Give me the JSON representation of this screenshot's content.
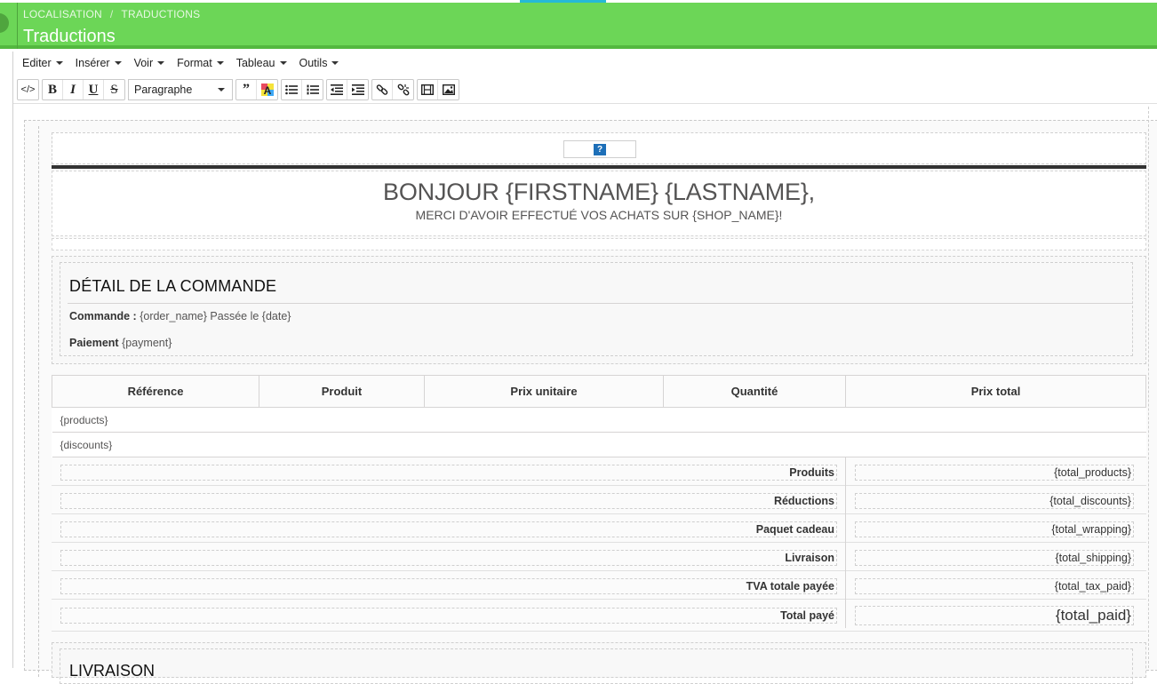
{
  "header": {
    "breadcrumb": [
      "LOCALISATION",
      "TRADUCTIONS"
    ],
    "breadcrumb_separator": "/",
    "title": "Traductions",
    "accent_color": "#6cd657"
  },
  "menubar": {
    "items": [
      "Editer",
      "Insérer",
      "Voir",
      "Format",
      "Tableau",
      "Outils"
    ]
  },
  "toolbar": {
    "format_select": "Paragraphe",
    "groups": [
      [
        "code-icon"
      ],
      [
        "bold-icon",
        "italic-icon",
        "underline-icon",
        "strikethrough-icon"
      ],
      [
        "blockquote-icon",
        "text-color-icon"
      ],
      [
        "bullet-list-icon",
        "numbered-list-icon"
      ],
      [
        "outdent-icon",
        "indent-icon"
      ],
      [
        "link-icon",
        "unlink-icon"
      ],
      [
        "media-icon",
        "image-icon"
      ]
    ]
  },
  "email": {
    "logo_placeholder": "?",
    "greeting": "BONJOUR {FIRSTNAME} {LASTNAME},",
    "subgreeting": "MERCI D'AVOIR EFFECTUÉ VOS ACHATS SUR {SHOP_NAME}!",
    "order_title": "DÉTAIL DE LA COMMANDE",
    "order_label": "Commande :",
    "order_value": "{order_name} Passée le {date}",
    "payment_label": "Paiement",
    "payment_value": "{payment}",
    "table_headers": [
      "Référence",
      "Produit",
      "Prix unitaire",
      "Quantité",
      "Prix total"
    ],
    "table_rows": [
      "{products}",
      "{discounts}"
    ],
    "totals": [
      {
        "label": "Produits",
        "value": "{total_products}"
      },
      {
        "label": "Réductions",
        "value": "{total_discounts}"
      },
      {
        "label": "Paquet cadeau",
        "value": "{total_wrapping}"
      },
      {
        "label": "Livraison",
        "value": "{total_shipping}"
      },
      {
        "label": "TVA totale payée",
        "value": "{total_tax_paid}"
      },
      {
        "label": "Total payé",
        "value": "{total_paid}"
      }
    ],
    "next_section_title": "LIVRAISON"
  }
}
